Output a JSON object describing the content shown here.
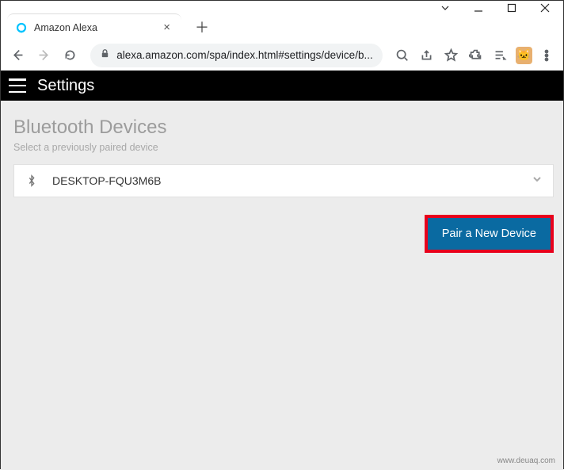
{
  "window": {
    "tab_title": "Amazon Alexa",
    "url": "alexa.amazon.com/spa/index.html#settings/device/b..."
  },
  "app_header": {
    "title": "Settings"
  },
  "page": {
    "title": "Bluetooth Devices",
    "subtitle": "Select a previously paired device"
  },
  "devices": [
    {
      "name": "DESKTOP-FQU3M6B"
    }
  ],
  "actions": {
    "pair_label": "Pair a New Device"
  },
  "watermark": "www.deuaq.com"
}
